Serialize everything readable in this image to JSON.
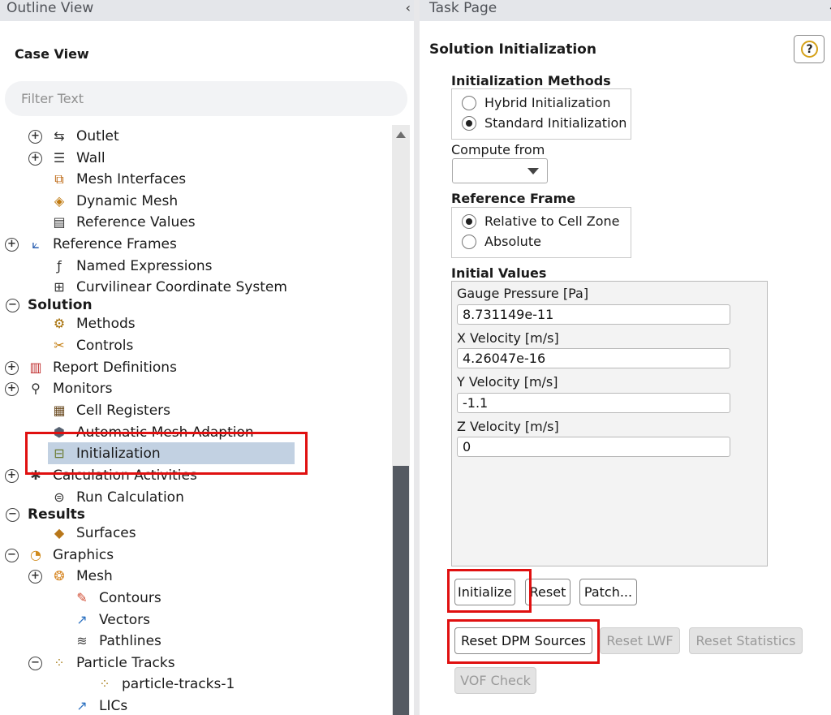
{
  "left_panel": {
    "title": "Outline View",
    "collapse_glyph": "‹",
    "case_view_label": "Case View",
    "filter_placeholder": "Filter Text",
    "tree": [
      {
        "label": "Outlet",
        "icon": "outlet-icon",
        "toggle": "+"
      },
      {
        "label": "Wall",
        "icon": "wall-icon",
        "toggle": "+"
      },
      {
        "label": "Mesh Interfaces",
        "icon": "mesh-interfaces-icon"
      },
      {
        "label": "Dynamic Mesh",
        "icon": "dynamic-mesh-icon"
      },
      {
        "label": "Reference Values",
        "icon": "reference-values-icon"
      },
      {
        "label": "Reference Frames",
        "icon": "reference-frames-icon",
        "toggle": "+"
      },
      {
        "label": "Named Expressions",
        "icon": "function-icon"
      },
      {
        "label": "Curvilinear Coordinate System",
        "icon": "grid-icon"
      },
      {
        "label": "Solution",
        "toggle": "−"
      },
      {
        "label": "Methods",
        "icon": "methods-icon"
      },
      {
        "label": "Controls",
        "icon": "controls-icon"
      },
      {
        "label": "Report Definitions",
        "icon": "report-definitions-icon",
        "toggle": "+"
      },
      {
        "label": "Monitors",
        "icon": "magnifier-icon",
        "toggle": "+"
      },
      {
        "label": "Cell Registers",
        "icon": "cell-registers-icon"
      },
      {
        "label": "Automatic Mesh Adaption",
        "icon": "mesh-adaption-icon"
      },
      {
        "label": "Initialization",
        "icon": "initialization-icon",
        "selected": true
      },
      {
        "label": "Calculation Activities",
        "icon": "calculation-activities-icon",
        "toggle": "+"
      },
      {
        "label": "Run Calculation",
        "icon": "run-calculation-icon"
      },
      {
        "label": "Results",
        "toggle": "−"
      },
      {
        "label": "Surfaces",
        "icon": "surfaces-icon"
      },
      {
        "label": "Graphics",
        "icon": "graphics-icon",
        "toggle": "−"
      },
      {
        "label": "Mesh",
        "icon": "mesh-icon",
        "toggle": "+"
      },
      {
        "label": "Contours",
        "icon": "contours-icon"
      },
      {
        "label": "Vectors",
        "icon": "vectors-icon"
      },
      {
        "label": "Pathlines",
        "icon": "pathlines-icon"
      },
      {
        "label": "Particle Tracks",
        "icon": "particle-tracks-icon",
        "toggle": "−"
      },
      {
        "label": "particle-tracks-1",
        "icon": "particle-tracks-item-icon"
      },
      {
        "label": "LICs",
        "icon": "lics-icon"
      }
    ]
  },
  "right_panel": {
    "title": "Task Page",
    "collapse_glyph": "‹",
    "heading": "Solution Initialization",
    "help_glyph": "?",
    "init_methods": {
      "title": "Initialization Methods",
      "options": [
        {
          "label": "Hybrid  Initialization",
          "selected": false
        },
        {
          "label": "Standard Initialization",
          "selected": true
        }
      ]
    },
    "compute_from": {
      "label": "Compute from",
      "value": ""
    },
    "reference_frame": {
      "title": "Reference Frame",
      "options": [
        {
          "label": "Relative to Cell Zone",
          "selected": true
        },
        {
          "label": "Absolute",
          "selected": false
        }
      ]
    },
    "initial_values": {
      "title": "Initial Values",
      "fields": [
        {
          "label": "Gauge Pressure [Pa]",
          "value": "8.731149e-11"
        },
        {
          "label": "X Velocity [m/s]",
          "value": "4.26047e-16"
        },
        {
          "label": "Y Velocity [m/s]",
          "value": "-1.1"
        },
        {
          "label": "Z Velocity [m/s]",
          "value": "0"
        }
      ]
    },
    "buttons": {
      "initialize": "Initialize",
      "reset": "Reset",
      "patch": "Patch...",
      "reset_dpm": "Reset DPM Sources",
      "reset_lwf": "Reset LWF",
      "reset_statistics": "Reset Statistics",
      "vof_check": "VOF Check"
    }
  },
  "colors": {
    "selection": "#c2d1e2",
    "highlight_box": "#e01010",
    "header_bg": "#e4e6ea",
    "scroll_thumb": "#555a62"
  }
}
